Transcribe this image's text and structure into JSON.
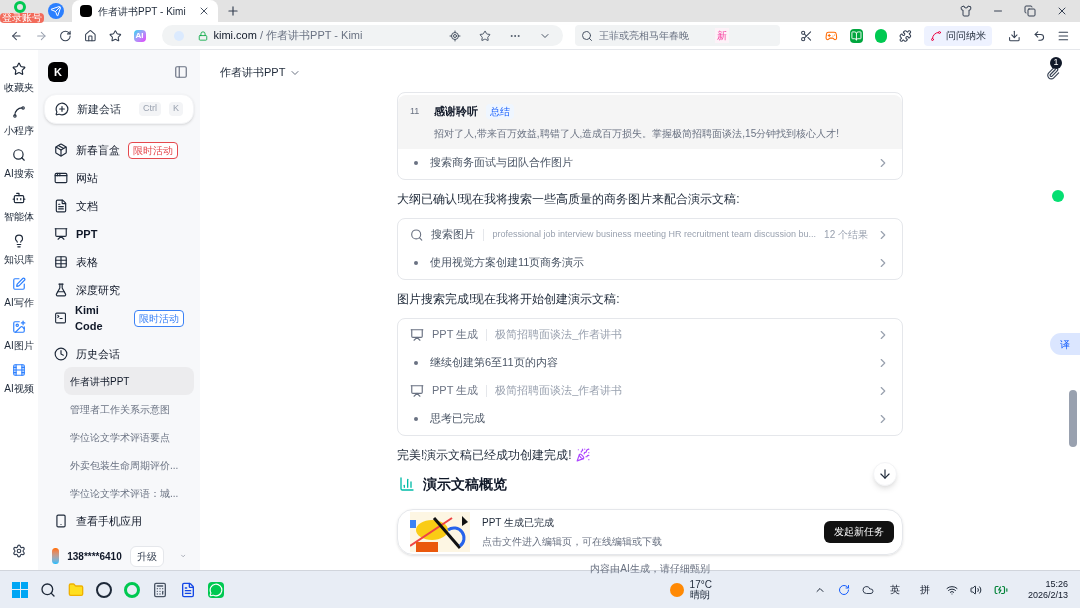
{
  "browser": {
    "login_badge": "登录账号",
    "tabs": [
      {
        "title": "作者讲书PPT - Kimi",
        "selected": true
      }
    ],
    "ai_label": "AI",
    "address": {
      "domain": "kimi.com",
      "path": " / 作者讲书PPT - Kimi"
    },
    "search": {
      "placeholder": "王菲或亮相马年春晚",
      "badge": "新"
    },
    "extension": "问问纳米"
  },
  "rail": [
    {
      "label": "收藏夹"
    },
    {
      "label": "小程序"
    },
    {
      "label": "AI搜索"
    },
    {
      "label": "智能体"
    },
    {
      "label": "知识库"
    },
    {
      "label": "AI写作"
    },
    {
      "label": "AI图片"
    },
    {
      "label": "AI视频"
    }
  ],
  "sidebar": {
    "logo": "K",
    "new_chat": {
      "label": "新建会话",
      "keys": [
        "Ctrl",
        "K"
      ]
    },
    "items": [
      {
        "label": "新春盲盒",
        "badge": {
          "text": "限时活动",
          "color": "#e5484d"
        }
      },
      {
        "label": "网站"
      },
      {
        "label": "文档"
      },
      {
        "label": "PPT"
      },
      {
        "label": "表格"
      },
      {
        "label": "深度研究"
      },
      {
        "label": "Kimi Code",
        "badge": {
          "text": "限时活动",
          "color": "#3b82f6"
        }
      }
    ],
    "history_title": "历史会话",
    "history": [
      {
        "label": "作者讲书PPT",
        "selected": true
      },
      {
        "label": "管理者工作关系示意图",
        "selected": false
      },
      {
        "label": "学位论文学术评语要点",
        "selected": false
      },
      {
        "label": "外卖包装生命周期评价...",
        "selected": false
      },
      {
        "label": "学位论文学术评语：城...",
        "selected": false
      }
    ],
    "mobile": "查看手机应用",
    "user": {
      "name": "138****6410",
      "upgrade": "升级"
    }
  },
  "header": {
    "title": "作者讲书PPT",
    "attachments": "1"
  },
  "blocks": [
    {
      "kind": "card",
      "steps": [
        {
          "kind": "slide",
          "number": "11",
          "title": "感谢聆听",
          "tag": "总结",
          "text": "招对了人,带来百万效益,聘错了人,造成百万损失。掌握极简招聘面谈法,15分钟找到核心人才!"
        },
        {
          "kind": "step",
          "label": "搜索商务面试与团队合作图片"
        }
      ]
    },
    {
      "kind": "text",
      "text": "大纲已确认!现在我将搜索一些高质量的商务图片来配合演示文稿:"
    },
    {
      "kind": "card",
      "steps": [
        {
          "kind": "search",
          "label": "搜索图片",
          "detail": "professional job interview business meeting HR recruitment team discussion bu...",
          "count": "12 个结果"
        },
        {
          "kind": "step",
          "label": "使用视觉方案创建11页商务演示"
        }
      ]
    },
    {
      "kind": "text",
      "text": "图片搜索完成!现在我将开始创建演示文稿:"
    },
    {
      "kind": "card",
      "steps": [
        {
          "kind": "ppt",
          "label": "PPT 生成",
          "detail": "极简招聘面谈法_作者讲书"
        },
        {
          "kind": "step",
          "label": "继续创建第6至11页的内容"
        },
        {
          "kind": "ppt",
          "label": "PPT 生成",
          "detail": "极简招聘面谈法_作者讲书"
        },
        {
          "kind": "step",
          "label": "思考已完成"
        }
      ]
    },
    {
      "kind": "celebrate",
      "text": "完美!演示文稿已经成功创建完成!"
    },
    {
      "kind": "heading",
      "text": "演示文稿概览"
    }
  ],
  "result": {
    "title": "PPT 生成已完成",
    "subtitle": "点击文件进入编辑页，可在线编辑或下载",
    "button": "发起新任务"
  },
  "disclaimer": "内容由AI生成，请仔细甄别",
  "floating": {
    "translate": "译"
  },
  "taskbar": {
    "weather": {
      "temp": "17°C",
      "desc": "晴朗"
    },
    "ime": [
      "英",
      "拼"
    ],
    "time": "15:26",
    "date": "2026/2/13"
  }
}
